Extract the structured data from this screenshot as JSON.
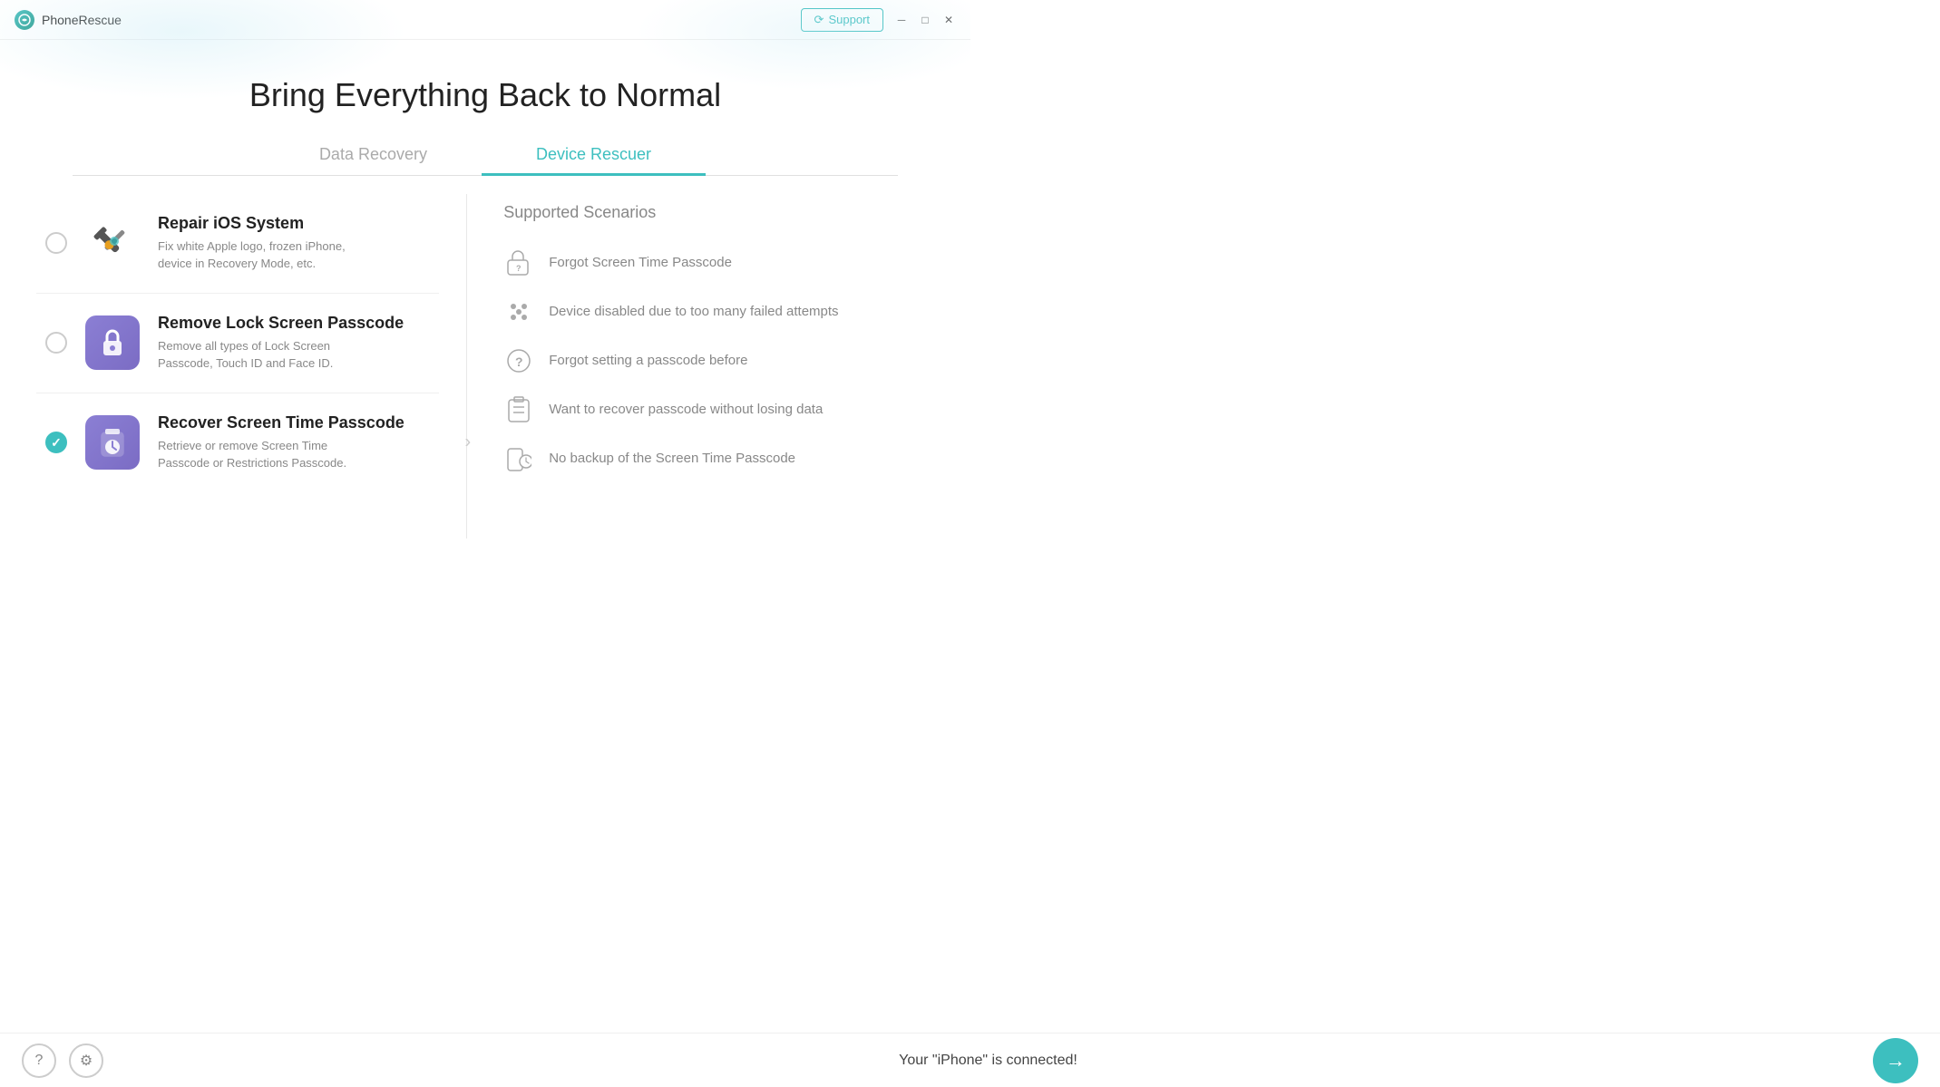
{
  "titleBar": {
    "appName": "PhoneRescue",
    "supportLabel": "Support",
    "windowControls": [
      "⊟",
      "─",
      "□",
      "✕"
    ]
  },
  "hero": {
    "title": "Bring Everything Back to Normal"
  },
  "tabs": [
    {
      "id": "data-recovery",
      "label": "Data Recovery",
      "active": false
    },
    {
      "id": "device-rescuer",
      "label": "Device Rescuer",
      "active": true
    }
  ],
  "options": [
    {
      "id": "repair-ios",
      "title": "Repair iOS System",
      "description": "Fix white Apple logo, frozen iPhone,\ndevice in Recovery Mode, etc.",
      "iconType": "tools",
      "selected": false
    },
    {
      "id": "remove-lock",
      "title": "Remove Lock Screen Passcode",
      "description": "Remove all types of Lock Screen\nPasscode, Touch ID and Face ID.",
      "iconType": "lock",
      "selected": false
    },
    {
      "id": "recover-screen-time",
      "title": "Recover Screen Time Passcode",
      "description": "Retrieve or remove Screen Time\nPasscode or Restrictions Passcode.",
      "iconType": "timer",
      "selected": true
    }
  ],
  "rightPanel": {
    "title": "Supported Scenarios",
    "scenarios": [
      {
        "id": "forgot-screen-time",
        "text": "Forgot Screen Time Passcode",
        "iconType": "lock-question"
      },
      {
        "id": "device-disabled",
        "text": "Device disabled due to too many failed attempts",
        "iconType": "dots"
      },
      {
        "id": "forgot-passcode-before",
        "text": "Forgot setting a passcode before",
        "iconType": "question"
      },
      {
        "id": "recover-no-data-loss",
        "text": "Want to recover passcode without losing data",
        "iconType": "clipboard"
      },
      {
        "id": "no-backup",
        "text": "No backup of the Screen Time Passcode",
        "iconType": "clock-doc"
      }
    ]
  },
  "footer": {
    "statusText": "Your \"iPhone\" is connected!",
    "helpLabel": "?",
    "settingsLabel": "⚙",
    "nextLabel": "→"
  }
}
